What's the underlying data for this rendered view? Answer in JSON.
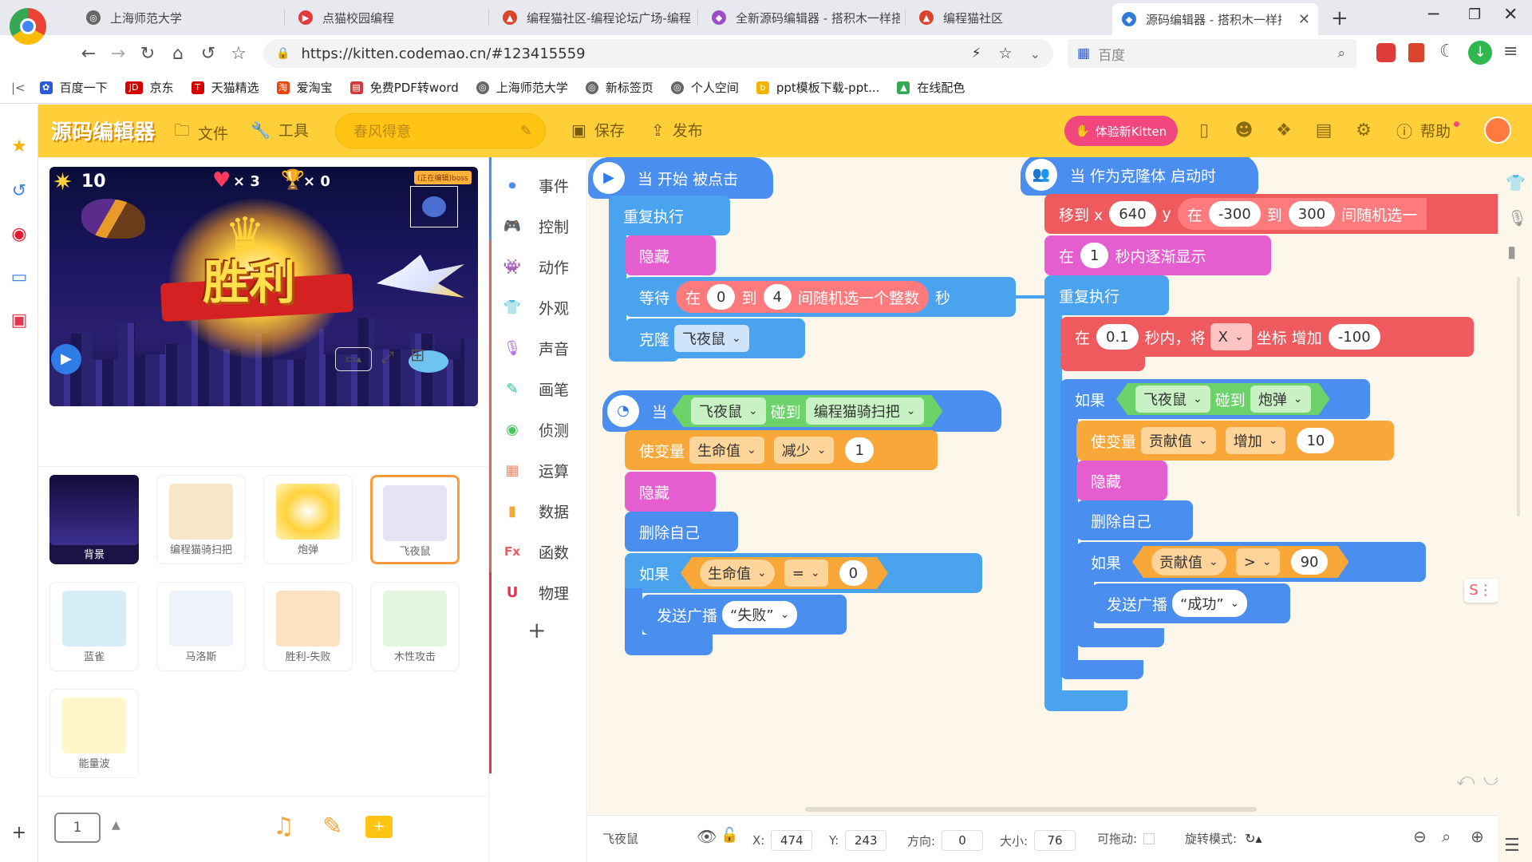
{
  "browser": {
    "tabs": [
      {
        "title": "上海师范大学",
        "icon_color": "#666"
      },
      {
        "title": "点猫校园编程",
        "icon_color": "#e23b3b"
      },
      {
        "title": "编程猫社区-编程论坛广场-编程",
        "icon_color": "#d9442b"
      },
      {
        "title": "全新源码编辑器 - 搭积木一样搭",
        "icon_color": "#9c4ec9"
      },
      {
        "title": "编程猫社区",
        "icon_color": "#d9442b"
      },
      {
        "title": "源码编辑器 - 搭积木一样搭",
        "icon_color": "#2f7ad8"
      }
    ],
    "new_tab": "+",
    "url": "https://kitten.codemao.cn/#123415559",
    "search_placeholder": "百度",
    "bookmarks": [
      {
        "label": "百度一下",
        "color": "#2d5bd8"
      },
      {
        "label": "京东",
        "color": "#d40000",
        "mark": "JD"
      },
      {
        "label": "天猫精选",
        "color": "#d40000",
        "mark": "T"
      },
      {
        "label": "爱淘宝",
        "color": "#e8460f",
        "mark": "淘"
      },
      {
        "label": "免费PDF转word",
        "color": "#d43a3a"
      },
      {
        "label": "上海师范大学",
        "color": "#666"
      },
      {
        "label": "新标签页",
        "color": "#666"
      },
      {
        "label": "个人空间",
        "color": "#666"
      },
      {
        "label": "ppt模板下载-ppt...",
        "color": "#f4b400",
        "mark": "b"
      },
      {
        "label": "在线配色",
        "color": "#34a853"
      }
    ]
  },
  "app": {
    "logo": "源码编辑器",
    "file_label": "文件",
    "tools_label": "工具",
    "project_name": "春风得意",
    "save_label": "保存",
    "publish_label": "发布",
    "try_new": "体验新Kitten",
    "help_label": "帮助"
  },
  "stage": {
    "energy": "10",
    "lives": "× 3",
    "trophy": "× 0",
    "victory_text": "胜利",
    "selected_sprite_tag": "(正在编辑)boss"
  },
  "sprites": [
    {
      "name": "背景",
      "color": "#1a1445"
    },
    {
      "name": "编程猫骑扫把",
      "color": "#f7e6c8"
    },
    {
      "name": "炮弹",
      "color": "#fff4c0"
    },
    {
      "name": "飞夜鼠",
      "color": "#e7e3f5",
      "selected": true
    },
    {
      "name": "蓝雀",
      "color": "#d6ecf7"
    },
    {
      "name": "马洛斯",
      "color": "#eef2fa"
    },
    {
      "name": "胜利-失败",
      "color": "#fbe3c2"
    },
    {
      "name": "木性攻击",
      "color": "#e3f7df"
    },
    {
      "name": "能量波",
      "color": "#fff6c9"
    }
  ],
  "bottom": {
    "scene_count": "1"
  },
  "categories": [
    {
      "label": "事件",
      "color": "#4a8ff0",
      "icon": "⏺"
    },
    {
      "label": "控制",
      "color": "#4aa3ef",
      "icon": "🎮"
    },
    {
      "label": "动作",
      "color": "#ef5a5e",
      "icon": "👾"
    },
    {
      "label": "外观",
      "color": "#e45ed0",
      "icon": "👕"
    },
    {
      "label": "声音",
      "color": "#b16ee8",
      "icon": "🎙"
    },
    {
      "label": "画笔",
      "color": "#2fbf8f",
      "icon": "✎"
    },
    {
      "label": "侦测",
      "color": "#47c75b",
      "icon": "◉"
    },
    {
      "label": "运算",
      "color": "#f58a6b",
      "icon": "▦"
    },
    {
      "label": "数据",
      "color": "#f8a738",
      "icon": "▮"
    },
    {
      "label": "函数",
      "color": "#ef5a5e",
      "icon": "Fx"
    },
    {
      "label": "物理",
      "color": "#e2364f",
      "icon": "U"
    }
  ],
  "add_category": "+",
  "blocks": {
    "s1": {
      "hat": "当 开始 被点击",
      "repeat": "重复执行",
      "hide": "隐藏",
      "wait": "等待",
      "wait_in": "在",
      "wait_from": "0",
      "wait_to_word": "到",
      "wait_to": "4",
      "wait_rand": "间随机选一个整数",
      "wait_sec": "秒",
      "clone": "克隆",
      "clone_target": "飞夜鼠"
    },
    "s2": {
      "hat": "当",
      "sprite": "飞夜鼠",
      "touch": "碰到",
      "target": "编程猫骑扫把",
      "setvar": "使变量",
      "var": "生命值",
      "op": "减少",
      "val": "1",
      "hide": "隐藏",
      "delete": "删除自己",
      "if": "如果",
      "cmp_var": "生命值",
      "cmp_op": "=",
      "cmp_val": "0",
      "broadcast": "发送广播",
      "msg": "“失败”"
    },
    "s3": {
      "hat": "当 作为克隆体 启动时",
      "moveto": "移到 x",
      "x": "640",
      "y_lbl": "y",
      "y_in": "在",
      "y_from": "-300",
      "y_to_word": "到",
      "y_to": "300",
      "y_rand": "间随机选一",
      "fade_in": "在",
      "fade_val": "1",
      "fade_txt": "秒内逐渐显示",
      "repeat": "重复执行",
      "glide_in": "在",
      "glide_val": "0.1",
      "glide_txt": "秒内，将",
      "axis": "X",
      "coord": "坐标 增加",
      "coord_val": "-100",
      "if": "如果",
      "sprite": "飞夜鼠",
      "touch": "碰到",
      "target": "炮弹",
      "setvar": "使变量",
      "var": "贡献值",
      "op": "增加",
      "val": "10",
      "hide": "隐藏",
      "delete": "删除自己",
      "if2": "如果",
      "cmp_var": "贡献值",
      "cmp_op": ">",
      "cmp_val": "90",
      "broadcast": "发送广播",
      "msg": "“成功”"
    }
  },
  "status": {
    "sprite_name": "飞夜鼠",
    "x_label": "X:",
    "x": "474",
    "y_label": "Y:",
    "y": "243",
    "dir_label": "方向:",
    "dir": "0",
    "size_label": "大小:",
    "size": "76",
    "drag_label": "可拖动:",
    "rot_label": "旋转模式:"
  }
}
